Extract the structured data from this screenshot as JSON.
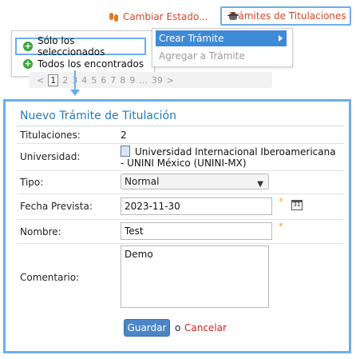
{
  "top_links": {
    "estado": "Cambiar Estado...",
    "titulaciones": "Trámites de Titulaciones"
  },
  "scope_menu": {
    "selected": "Sólo los seleccionados",
    "all": "Todos los encontrados"
  },
  "action_menu": {
    "create": "Crear Trámite",
    "add": "Agregar a Trámite"
  },
  "pager": {
    "prev": "<",
    "pages": [
      "1",
      "2",
      "3",
      "4",
      "5",
      "6",
      "7",
      "8",
      "9",
      "...",
      "39"
    ],
    "current": "1",
    "next": ">"
  },
  "form": {
    "title": "Nuevo Trámite de Titulación",
    "titulaciones_label": "Titulaciones:",
    "titulaciones_value": "2",
    "universidad_label": "Universidad:",
    "universidad_line1": "Universidad Internacional Iberoamericana",
    "universidad_line2": "- UNINI México (UNINI-MX)",
    "tipo_label": "Tipo:",
    "tipo_value": "Normal",
    "fecha_label": "Fecha Prevista:",
    "fecha_value": "2023-11-30",
    "calendar_day": "31",
    "nombre_label": "Nombre:",
    "nombre_value": "Test",
    "comentario_label": "Comentario:",
    "comentario_value": "Demo",
    "required_mark": "*",
    "save": "Guardar",
    "or": "o",
    "cancel": "Cancelar"
  }
}
